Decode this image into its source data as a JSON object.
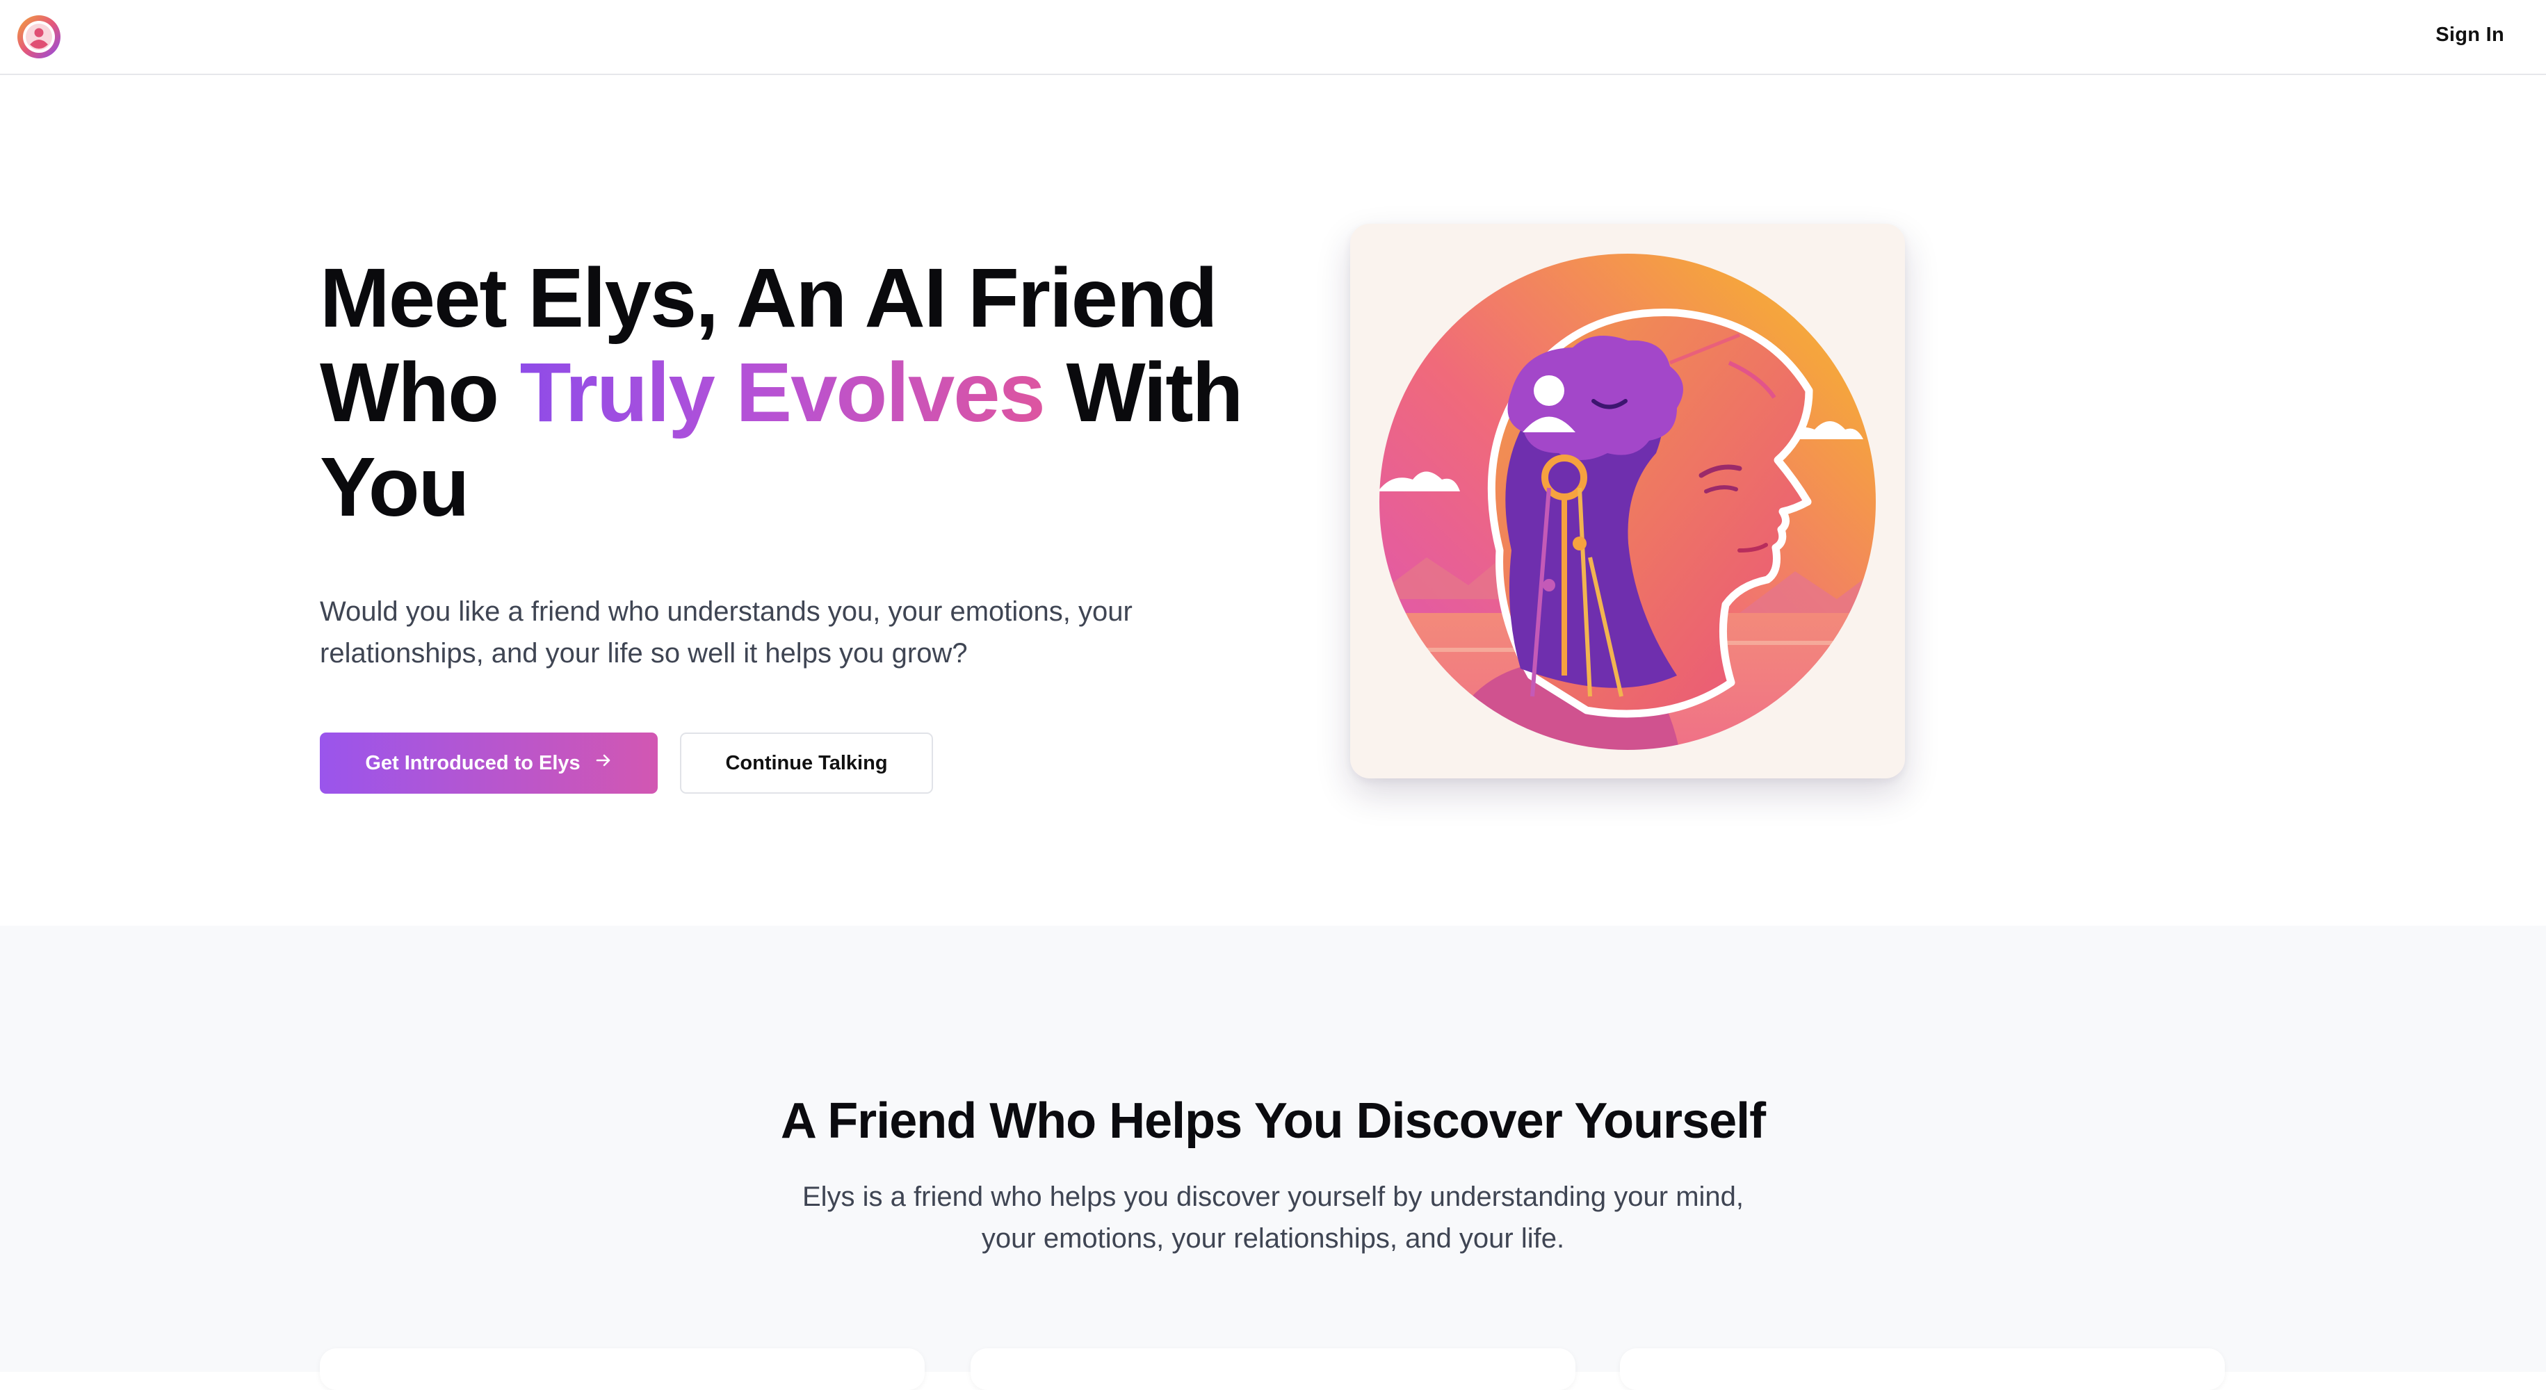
{
  "nav": {
    "logo_icon": "user-circle-logo-icon",
    "signin_label": "Sign In"
  },
  "hero": {
    "title_part1": "Meet Elys, An AI Friend Who ",
    "title_highlight": "Truly Evolves",
    "title_part2": " With You",
    "subtitle": "Would you like a friend who understands you, your emotions, your relationships, and your life so well it helps you grow?",
    "primary_button": "Get Introduced to Elys",
    "primary_button_icon": "arrow-right-icon",
    "secondary_button": "Continue Talking",
    "illustration": "ai-head-profile-illustration"
  },
  "features": {
    "title": "A Friend Who Helps You Discover Yourself",
    "subtitle": "Elys is a friend who helps you discover yourself by understanding your mind, your emotions, your relationships, and your life."
  },
  "colors": {
    "accent_start": "#9a55ec",
    "accent_end": "#d257b2",
    "text_dark": "#0a0a0d",
    "text_muted": "#3f4553",
    "section_bg": "#f8f9fb"
  }
}
